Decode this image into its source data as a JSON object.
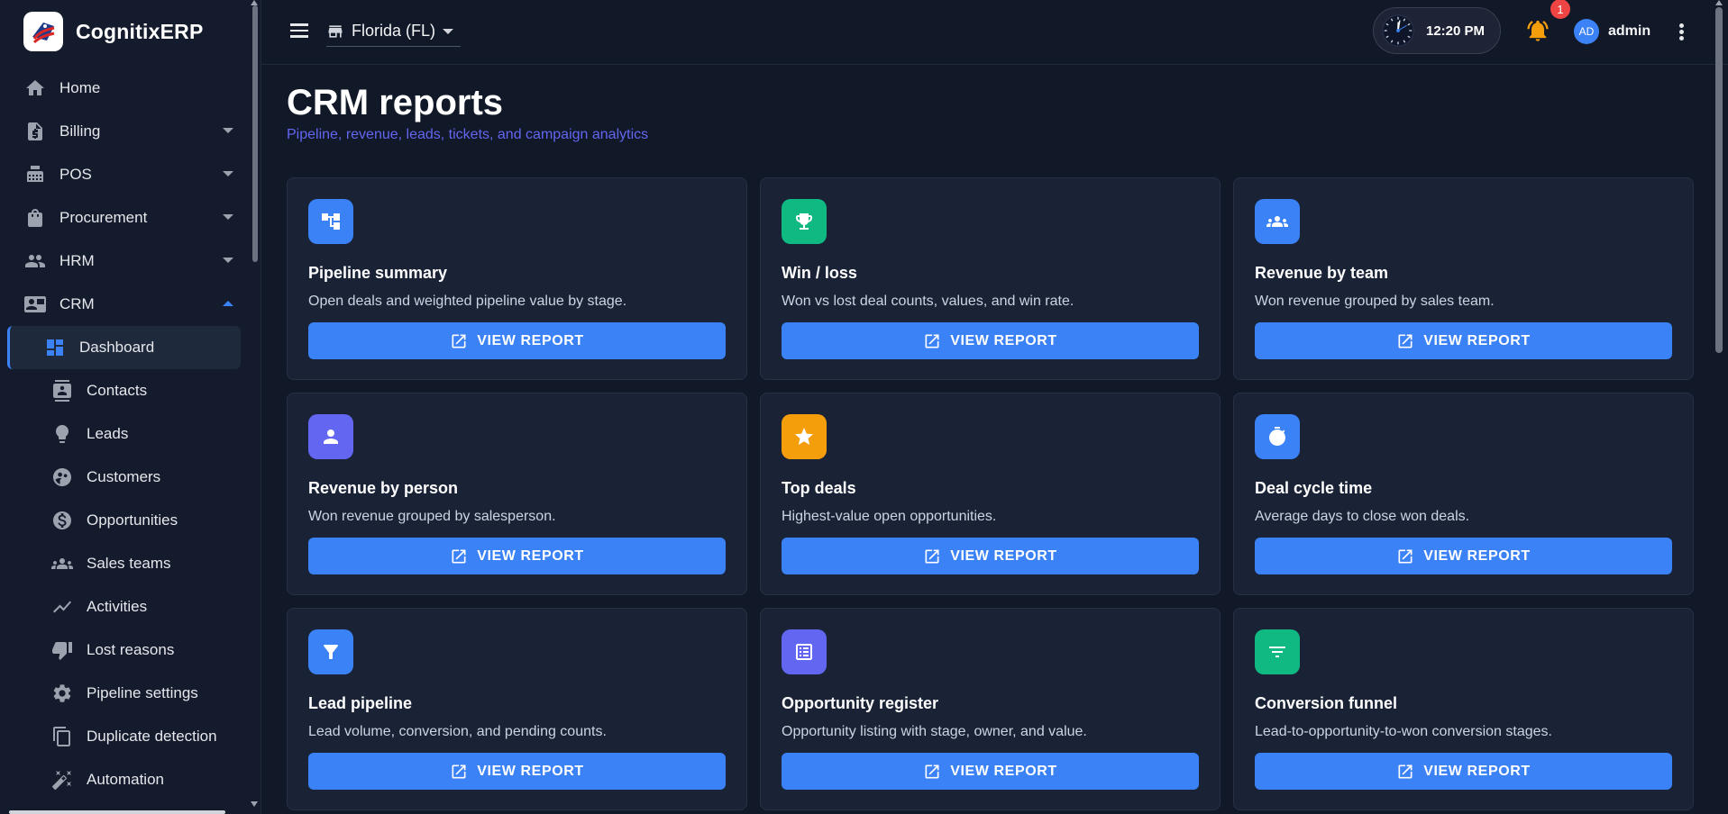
{
  "brand": {
    "name": "CognitixERP"
  },
  "sidebar": {
    "items": [
      {
        "label": "Home",
        "icon": "home-icon"
      },
      {
        "label": "Billing",
        "icon": "billing-icon"
      },
      {
        "label": "POS",
        "icon": "pos-icon"
      },
      {
        "label": "Procurement",
        "icon": "bag-icon"
      },
      {
        "label": "HRM",
        "icon": "people-icon"
      },
      {
        "label": "CRM",
        "icon": "contact-card-icon"
      }
    ],
    "crm_items": [
      {
        "label": "Dashboard",
        "icon": "dashboard-icon"
      },
      {
        "label": "Contacts",
        "icon": "contacts-icon"
      },
      {
        "label": "Leads",
        "icon": "lightbulb-icon"
      },
      {
        "label": "Customers",
        "icon": "customers-icon"
      },
      {
        "label": "Opportunities",
        "icon": "dollar-icon"
      },
      {
        "label": "Sales teams",
        "icon": "groups-icon"
      },
      {
        "label": "Activities",
        "icon": "trend-icon"
      },
      {
        "label": "Lost reasons",
        "icon": "thumb-down-icon"
      },
      {
        "label": "Pipeline settings",
        "icon": "gear-icon"
      },
      {
        "label": "Duplicate detection",
        "icon": "copy-icon"
      },
      {
        "label": "Automation",
        "icon": "wand-icon"
      }
    ]
  },
  "topbar": {
    "location": "Florida (FL)",
    "time": "12:20 PM",
    "notification_count": "1",
    "avatar_initials": "AD",
    "user_name": "admin"
  },
  "page": {
    "title": "CRM reports",
    "subtitle": "Pipeline, revenue, leads, tickets, and campaign analytics"
  },
  "button_label": "VIEW REPORT",
  "cards": [
    {
      "title": "Pipeline summary",
      "desc": "Open deals and weighted pipeline value by stage.",
      "icon": "hierarchy-icon",
      "color": "#3b82f6"
    },
    {
      "title": "Win / loss",
      "desc": "Won vs lost deal counts, values, and win rate.",
      "icon": "trophy-icon",
      "color": "#10b981"
    },
    {
      "title": "Revenue by team",
      "desc": "Won revenue grouped by sales team.",
      "icon": "groups-icon",
      "color": "#3b82f6"
    },
    {
      "title": "Revenue by person",
      "desc": "Won revenue grouped by salesperson.",
      "icon": "person-icon",
      "color": "#6366f1"
    },
    {
      "title": "Top deals",
      "desc": "Highest-value open opportunities.",
      "icon": "star-icon",
      "color": "#f59e0b"
    },
    {
      "title": "Deal cycle time",
      "desc": "Average days to close won deals.",
      "icon": "timer-icon",
      "color": "#3b82f6"
    },
    {
      "title": "Lead pipeline",
      "desc": "Lead volume, conversion, and pending counts.",
      "icon": "filter-icon",
      "color": "#3b82f6"
    },
    {
      "title": "Opportunity register",
      "desc": "Opportunity listing with stage, owner, and value.",
      "icon": "list-icon",
      "color": "#6366f1"
    },
    {
      "title": "Conversion funnel",
      "desc": "Lead-to-opportunity-to-won conversion stages.",
      "icon": "funnel-lines-icon",
      "color": "#10b981"
    }
  ],
  "colors": {
    "accent": "#3b82f6",
    "background": "#111827",
    "card": "#1a2236"
  }
}
